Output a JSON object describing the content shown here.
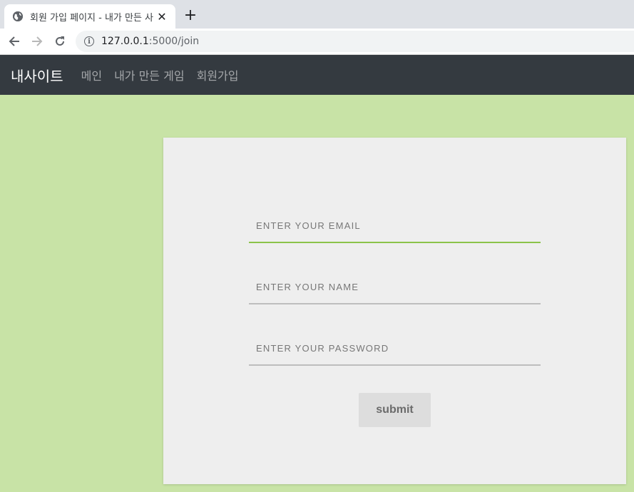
{
  "browser": {
    "tab_title": "회원 가입 페이지 - 내가 만든 사",
    "url_host": "127.0.0.1",
    "url_path": ":5000/join"
  },
  "navbar": {
    "brand": "내사이트",
    "links": [
      "메인",
      "내가 만든 게임",
      "회원가입"
    ]
  },
  "form": {
    "email_placeholder": "ENTER YOUR EMAIL",
    "name_placeholder": "ENTER YOUR NAME",
    "password_placeholder": "ENTER YOUR PASSWORD",
    "submit_label": "submit"
  },
  "colors": {
    "page_background": "#c8e3a6",
    "navbar": "#343a40",
    "card": "#eeeeee",
    "active_underline": "#8bc34a"
  }
}
